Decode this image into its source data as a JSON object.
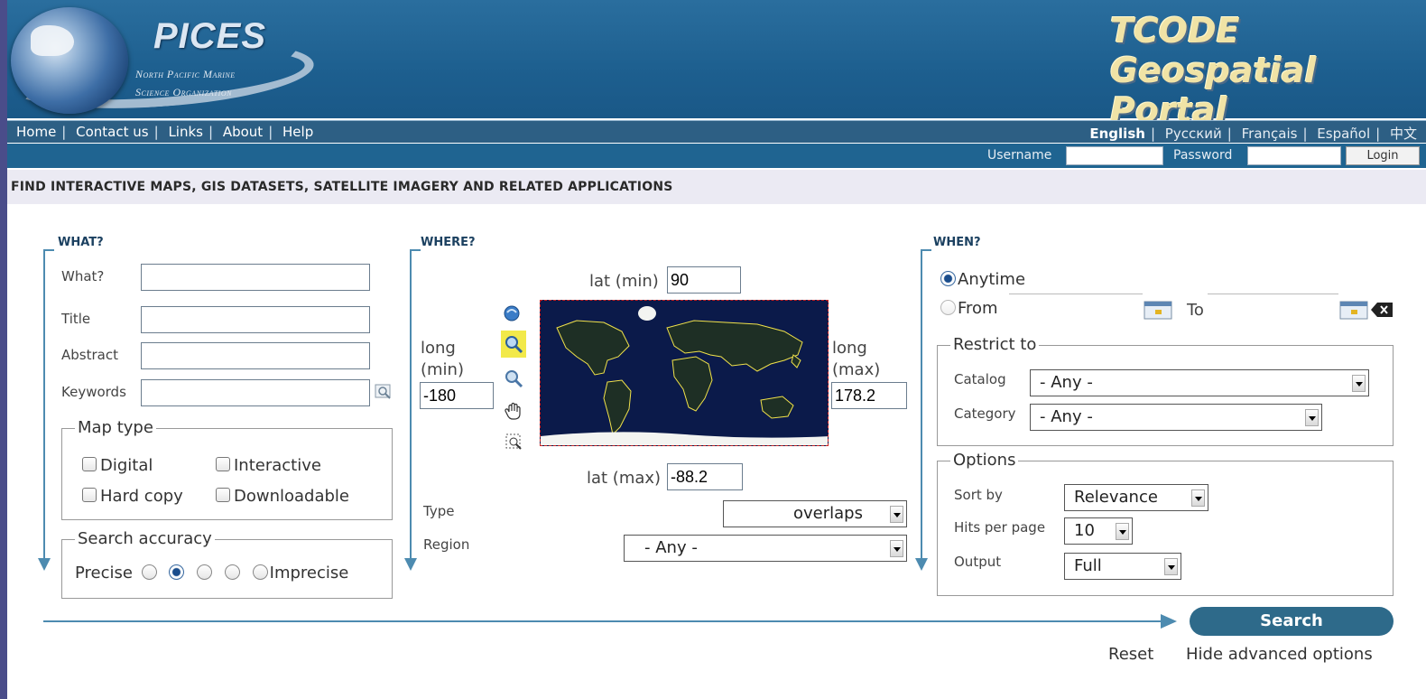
{
  "header": {
    "pices_title": "PICES",
    "pices_sub1": "North Pacific Marine",
    "pices_sub2": "Science Organization",
    "portal_title_l1": "TCODE",
    "portal_title_l2": "Geospatial",
    "portal_title_l3": "Portal"
  },
  "nav": {
    "links": [
      "Home",
      "Contact us",
      "Links",
      "About",
      "Help"
    ],
    "languages": [
      "English",
      "Русский",
      "Français",
      "Español",
      "中文"
    ],
    "active_language": "English"
  },
  "login": {
    "username_label": "Username",
    "password_label": "Password",
    "login_label": "Login"
  },
  "banner": "FIND INTERACTIVE MAPS, GIS DATASETS, SATELLITE IMAGERY AND RELATED APPLICATIONS",
  "what": {
    "title": "WHAT?",
    "fields": [
      {
        "label": "What?",
        "value": ""
      },
      {
        "label": "Title",
        "value": ""
      },
      {
        "label": "Abstract",
        "value": ""
      },
      {
        "label": "Keywords",
        "value": ""
      }
    ],
    "map_type_legend": "Map type",
    "map_types": [
      "Digital",
      "Interactive",
      "Hard copy",
      "Downloadable"
    ],
    "accuracy_legend": "Search accuracy",
    "accuracy_precise": "Precise",
    "accuracy_imprecise": "Imprecise",
    "accuracy_selected_index": 1
  },
  "where": {
    "title": "WHERE?",
    "lat_min_label": "lat (min)",
    "lat_min": "90",
    "long_min_label_1": "long",
    "long_min_label_2": "(min)",
    "long_min": "-180",
    "long_max_label_1": "long",
    "long_max_label_2": "(max)",
    "long_max": "178.2",
    "lat_max_label": "lat (max)",
    "lat_max": "-88.2",
    "type_label": "Type",
    "type_value": "overlaps",
    "region_label": "Region",
    "region_value": "- Any -"
  },
  "when": {
    "title": "WHEN?",
    "anytime_label": "Anytime",
    "from_label": "From",
    "to_label": "To",
    "from_value": "",
    "to_value": "",
    "restrict_legend": "Restrict to",
    "catalog_label": "Catalog",
    "catalog_value": "- Any -",
    "category_label": "Category",
    "category_value": "- Any -",
    "options_legend": "Options",
    "sort_label": "Sort by",
    "sort_value": "Relevance",
    "hits_label": "Hits per page",
    "hits_value": "10",
    "output_label": "Output",
    "output_value": "Full"
  },
  "actions": {
    "search_label": "Search",
    "reset_label": "Reset",
    "hide_label": "Hide advanced options"
  },
  "colors": {
    "header_blue": "#1d5f8f",
    "nav_blue": "#2d5f84",
    "accent_line": "#4d8bb0",
    "search_button": "#2e6a8a",
    "map_ocean": "#0b1a4a",
    "map_borders": "#f1e24a"
  }
}
